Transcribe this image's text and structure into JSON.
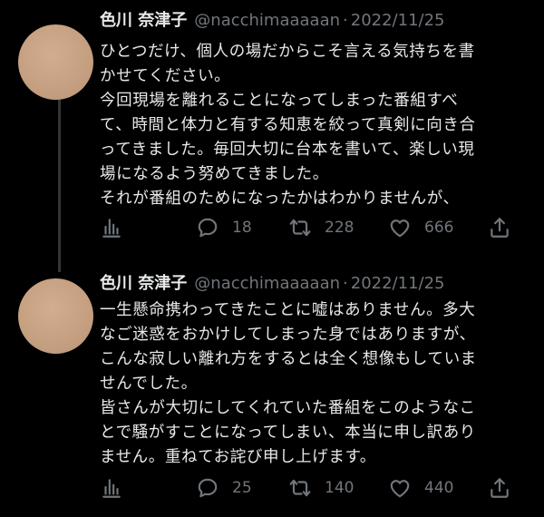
{
  "tweets": [
    {
      "display_name": "色川 奈津子",
      "handle": "@nacchimaaaaan",
      "separator": "·",
      "date": "2022/11/25",
      "lines": [
        "ひとつだけ、個人の場だからこそ言える気持ちを書",
        "かせてください。",
        "今回現場を離れることになってしまった番組すべ",
        "て、時間と体力と有する知恵を絞って真剣に向き合",
        "ってきました。毎回大切に台本を書いて、楽しい現",
        "場になるよう努めてきました。",
        "それが番組のためになったかはわかりませんが、"
      ],
      "counts": {
        "replies": "18",
        "retweets": "228",
        "likes": "666"
      }
    },
    {
      "display_name": "色川 奈津子",
      "handle": "@nacchimaaaaan",
      "separator": "·",
      "date": "2022/11/25",
      "lines": [
        "一生懸命携わってきたことに嘘はありません。多大",
        "なご迷惑をおかけしてしまった身ではありますが、",
        "こんな寂しい離れ方をするとは全く想像もしていま",
        "せんでした。",
        "皆さんが大切にしてくれていた番組をこのようなこ",
        "とで騒がすことになってしまい、本当に申し訳あり",
        "ません。重ねてお詫び申し上げます。"
      ],
      "counts": {
        "replies": "25",
        "retweets": "140",
        "likes": "440"
      }
    }
  ],
  "icons": {
    "views": "bar-chart-icon",
    "reply": "speech-bubble-icon",
    "retweet": "retweet-arrows-icon",
    "like": "heart-icon",
    "share": "share-upload-icon"
  },
  "colors": {
    "background": "#000000",
    "text_primary": "#e7e9ea",
    "text_secondary": "#71767b",
    "thread_line": "#333639",
    "avatar": "#c9a486"
  }
}
